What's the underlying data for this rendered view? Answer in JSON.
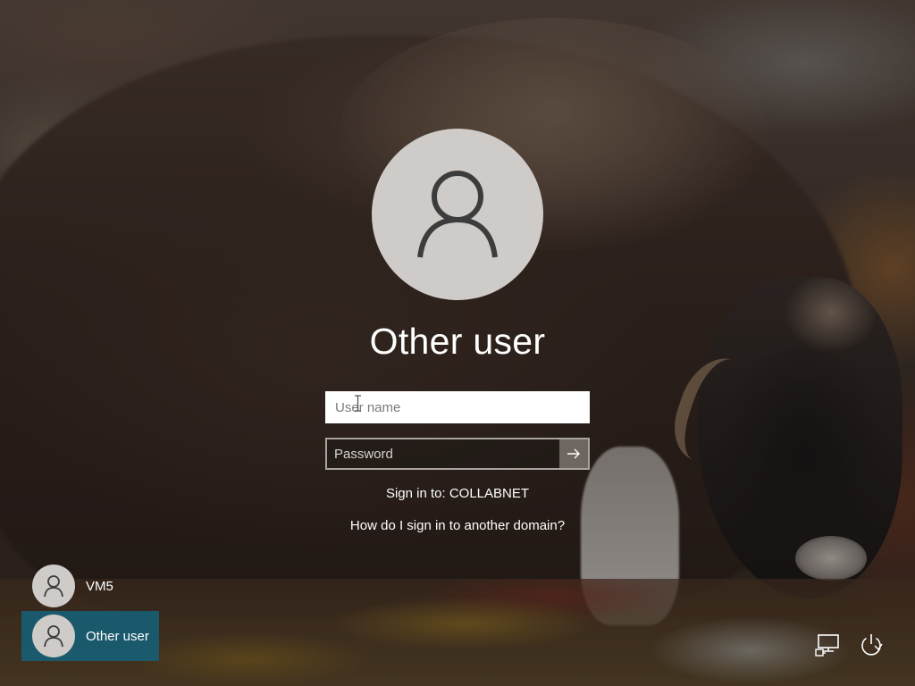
{
  "screen": {
    "type": "windows-lock-screen",
    "background_description_icon": "musk-ox-wallpaper"
  },
  "selected_user": {
    "display_name": "Other user",
    "avatar_icon": "user-silhouette-icon"
  },
  "form": {
    "username_placeholder": "User name",
    "username_value": "",
    "password_placeholder": "Password",
    "password_value": "",
    "submit_icon": "arrow-right-icon"
  },
  "domain": {
    "sign_in_text": "Sign in to: COLLABNET",
    "help_link": "How do I sign in to another domain?"
  },
  "user_list": [
    {
      "name": "VM5",
      "selected": false,
      "avatar_icon": "user-silhouette-icon"
    },
    {
      "name": "Other user",
      "selected": true,
      "avatar_icon": "user-silhouette-icon"
    }
  ],
  "system_buttons": [
    {
      "icon": "network-icon"
    },
    {
      "icon": "power-icon"
    }
  ],
  "colors": {
    "selected_tile": "#166078",
    "avatar_bg": "#cecbc8",
    "text": "#ffffff"
  }
}
